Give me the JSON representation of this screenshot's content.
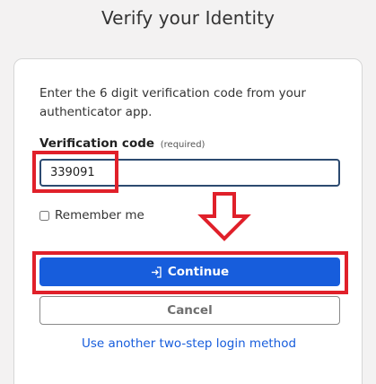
{
  "page": {
    "title": "Verify your Identity"
  },
  "form": {
    "instructions": "Enter the 6 digit verification code from your authenticator app.",
    "code_label": "Verification code",
    "code_required": "(required)",
    "code_value": "339091",
    "remember_label": "Remember me",
    "remember_checked": false,
    "continue_label": "Continue",
    "cancel_label": "Cancel",
    "alt_method_link": "Use another two-step login method"
  },
  "colors": {
    "primary": "#175ddc",
    "annotation_red": "#e0202a",
    "input_border": "#2c4a70"
  },
  "icons": {
    "continue": "sign-in-icon",
    "annotation_arrow": "arrow-down-icon"
  }
}
